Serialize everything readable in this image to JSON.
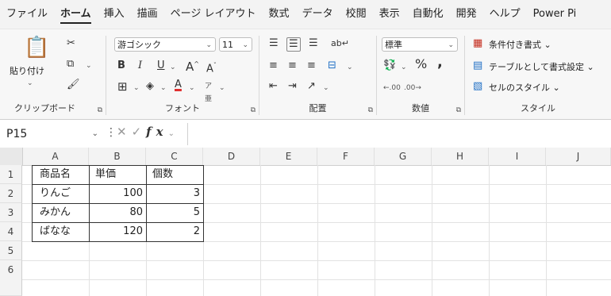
{
  "menu": {
    "tabs": [
      "ファイル",
      "ホーム",
      "挿入",
      "描画",
      "ページ レイアウト",
      "数式",
      "データ",
      "校閲",
      "表示",
      "自動化",
      "開発",
      "ヘルプ",
      "Power Pi"
    ],
    "active": "ホーム"
  },
  "ribbon": {
    "clipboard": {
      "paste_label": "貼り付け",
      "group_label": "クリップボード"
    },
    "font": {
      "font_name": "游ゴシック",
      "font_size": "11",
      "group_label": "フォント"
    },
    "alignment": {
      "group_label": "配置"
    },
    "number": {
      "format": "標準",
      "group_label": "数値"
    },
    "styles": {
      "conditional": "条件付き書式",
      "table": "テーブルとして書式設定",
      "cell": "セルのスタイル",
      "group_label": "スタイル"
    }
  },
  "formula_bar": {
    "name_box": "P15",
    "fx": "fx",
    "value": ""
  },
  "sheet": {
    "columns": [
      "A",
      "B",
      "C",
      "D",
      "E",
      "F",
      "G",
      "H",
      "I",
      "J"
    ],
    "rows": [
      "1",
      "2",
      "3",
      "4",
      "5",
      "6"
    ],
    "cells": {
      "A1": "商品名",
      "B1": "単価",
      "C1": "個数",
      "A2": "りんご",
      "B2": "100",
      "C2": "3",
      "A3": "みかん",
      "B3": "80",
      "C3": "5",
      "A4": "ばなな",
      "B4": "120",
      "C4": "2"
    }
  }
}
